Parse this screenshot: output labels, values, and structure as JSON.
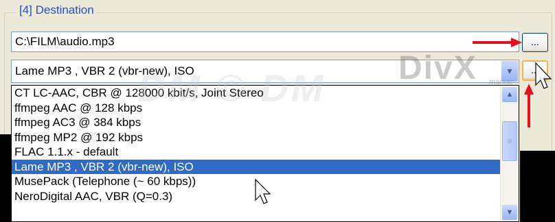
{
  "group": {
    "label": "[4] Destination"
  },
  "destination_path": {
    "value": "C:\\FILM\\audio.mp3"
  },
  "browse_path_button": {
    "label": "..."
  },
  "codec_combo": {
    "value": "Lame MP3 , VBR 2 (vbr-new), ISO"
  },
  "codec_settings_button": {
    "label": "..."
  },
  "codec_list": {
    "items": [
      {
        "label": "CT LC-AAC, CBR @ 128000 kbit/s, Joint Stereo"
      },
      {
        "label": "ffmpeg AAC @ 128 kbps"
      },
      {
        "label": "ffmpeg AC3 @ 384 kbps"
      },
      {
        "label": "ffmpeg MP2 @ 192 kbps"
      },
      {
        "label": "FLAC 1.1.x - default"
      },
      {
        "label": "Lame MP3 , VBR 2 (vbr-new), ISO"
      },
      {
        "label": "MusePack (Telephone (~ 60 kbps))"
      },
      {
        "label": "NeroDigital AAC, VBR (Q=0.3)"
      }
    ],
    "selected_index": 5
  },
  "watermark": {
    "logo": "DivX",
    "sub": "maniac",
    "text": "DM © DM"
  },
  "colors": {
    "selection": "#316ac5",
    "group_label": "#1f4fd1",
    "arrow": "#e8101a"
  }
}
